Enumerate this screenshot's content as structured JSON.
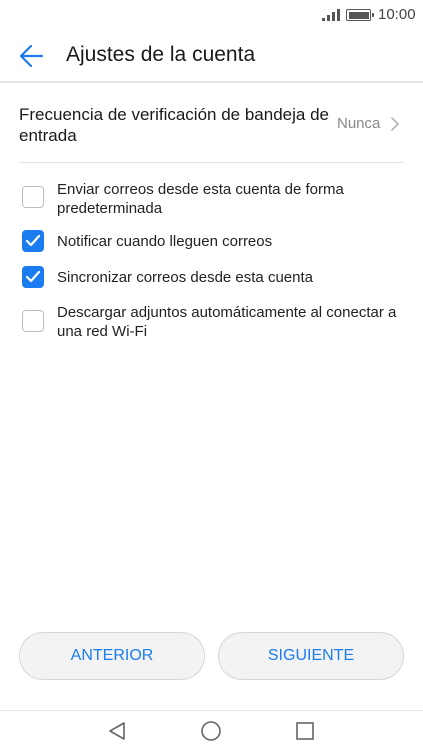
{
  "status_bar": {
    "time": "10:00",
    "icons": [
      "signal-icon",
      "battery-icon"
    ]
  },
  "app_bar": {
    "title": "Ajustes de la cuenta",
    "back_icon": "arrow-back-icon",
    "accent_color": "#1a7cf0"
  },
  "frequency": {
    "label": "Frecuencia de verificación de bandeja de entrada",
    "value": "Nunca",
    "icon": "chevron-right-icon"
  },
  "options": [
    {
      "label": "Enviar correos desde esta cuenta de forma predeterminada",
      "checked": false
    },
    {
      "label": "Notificar cuando lleguen correos",
      "checked": true
    },
    {
      "label": "Sincronizar correos desde esta cuenta",
      "checked": true
    },
    {
      "label": "Descargar adjuntos automáticamente al conectar a una red Wi-Fi",
      "checked": false
    }
  ],
  "buttons": {
    "previous": "ANTERIOR",
    "next": "SIGUIENTE"
  },
  "nav_bar": {
    "icons": [
      "nav-back-icon",
      "nav-home-icon",
      "nav-recents-icon"
    ]
  }
}
